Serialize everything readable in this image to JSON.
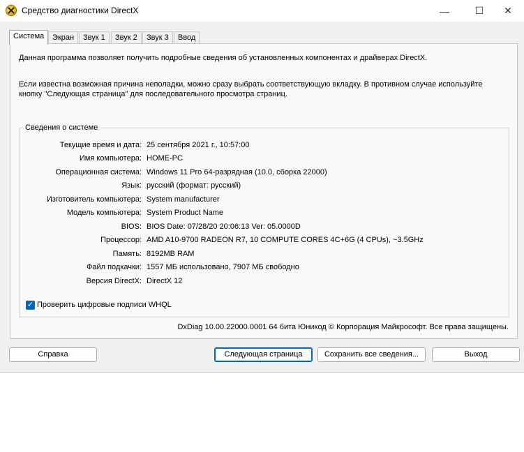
{
  "window": {
    "title": "Средство диагностики DirectX",
    "controls": {
      "minimize": "—",
      "maximize": "☐",
      "close": "✕"
    }
  },
  "tabs": [
    {
      "label": "Система",
      "active": true
    },
    {
      "label": "Экран"
    },
    {
      "label": "Звук 1"
    },
    {
      "label": "Звук 2"
    },
    {
      "label": "Звук 3"
    },
    {
      "label": "Ввод"
    }
  ],
  "intro": {
    "line1": "Данная программа позволяет получить подробные сведения об установленных компонентах и драйверах DirectX.",
    "line2": "Если известна возможная причина неполадки, можно сразу выбрать соответствующую вкладку. В противном случае используйте кнопку \"Следующая страница\" для последовательного просмотра страниц."
  },
  "system_info": {
    "group_title": "Сведения о системе",
    "rows": [
      {
        "label": "Текущие время и дата:",
        "value": "25 сентября 2021 г., 10:57:00"
      },
      {
        "label": "Имя компьютера:",
        "value": "HOME-PC"
      },
      {
        "label": "Операционная система:",
        "value": "Windows 11 Pro 64-разрядная (10.0, сборка 22000)"
      },
      {
        "label": "Язык:",
        "value": "русский (формат: русский)"
      },
      {
        "label": "Изготовитель компьютера:",
        "value": "System manufacturer"
      },
      {
        "label": "Модель компьютера:",
        "value": "System Product Name"
      },
      {
        "label": "BIOS:",
        "value": "BIOS Date: 07/28/20 20:06:13 Ver: 05.0000D"
      },
      {
        "label": "Процессор:",
        "value": "AMD A10-9700 RADEON R7, 10 COMPUTE CORES 4C+6G  (4 CPUs), ~3.5GHz"
      },
      {
        "label": "Память:",
        "value": "8192MB RAM"
      },
      {
        "label": "Файл подкачки:",
        "value": "1557 МБ использовано, 7907 МБ свободно"
      },
      {
        "label": "Версия DirectX:",
        "value": "DirectX 12"
      }
    ]
  },
  "whql_checkbox": {
    "label": "Проверить цифровые подписи WHQL",
    "checked": true
  },
  "footer": "DxDiag 10.00.22000.0001 64 бита Юникод  © Корпорация Майкрософт. Все права защищены.",
  "buttons": {
    "help": "Справка",
    "next": "Следующая страница",
    "save": "Сохранить все сведения...",
    "exit": "Выход"
  }
}
